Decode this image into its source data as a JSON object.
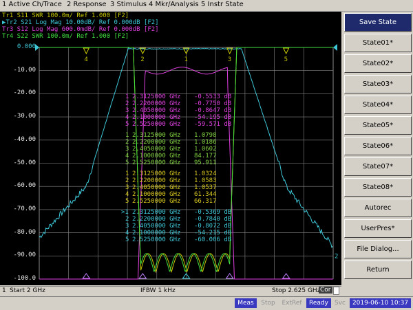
{
  "menu": [
    "1 Active Ch/Trace",
    "2 Response",
    "3 Stimulus",
    "4 Mkr/Analysis",
    "5 Instr State"
  ],
  "traces": [
    {
      "label": "Tr1  S11  SWR 100.0m/ Ref 1.000  [F2]",
      "color": "#c8c800"
    },
    {
      "label": "Tr2  S21  Log Mag 10.00dB/ Ref 0.000dB  [F2]",
      "color": "#3ec8d8"
    },
    {
      "label": "Tr3  S12  Log Mag 600.0mdB/ Ref 0.000dB  [F2]",
      "color": "#e040e0"
    },
    {
      "label": "Tr4  S22  SWR 100.0m/ Ref 1.000  [F2]",
      "color": "#40e040"
    }
  ],
  "active_trace_marker": "▶",
  "y_axis": {
    "labels": [
      "0.000",
      "-10.00",
      "-20.00",
      "-30.00",
      "-40.00",
      "-50.00",
      "-60.00",
      "-70.00",
      "-80.00",
      "-90.00",
      "-100.0"
    ],
    "unit": "dB"
  },
  "marker_tables": [
    {
      "color": "#e040e0",
      "rows": [
        {
          "n": "1",
          "freq": "2.3125000 GHz",
          "val": "-0.5533 dB"
        },
        {
          "n": "2",
          "freq": "2.2200000 GHz",
          "val": "-0.7750 dB"
        },
        {
          "n": "3",
          "freq": "2.4050000 GHz",
          "val": "-0.8647 dB"
        },
        {
          "n": "4",
          "freq": "2.1000000 GHz",
          "val": "-54.195 dB"
        },
        {
          "n": "5",
          "freq": "2.5250000 GHz",
          "val": "-59.571 dB"
        }
      ]
    },
    {
      "color": "#80d040",
      "rows": [
        {
          "n": "1",
          "freq": "2.3125000 GHz",
          "val": "1.0798"
        },
        {
          "n": "2",
          "freq": "2.2200000 GHz",
          "val": "1.0186"
        },
        {
          "n": "3",
          "freq": "2.4050000 GHz",
          "val": "1.0602"
        },
        {
          "n": "4",
          "freq": "2.1000000 GHz",
          "val": "84.177"
        },
        {
          "n": "5",
          "freq": "2.5250000 GHz",
          "val": "95.911"
        }
      ]
    },
    {
      "color": "#d8c820",
      "rows": [
        {
          "n": "1",
          "freq": "2.3125000 GHz",
          "val": "1.0324"
        },
        {
          "n": "2",
          "freq": "2.2200000 GHz",
          "val": "1.0583"
        },
        {
          "n": "3",
          "freq": "2.4050000 GHz",
          "val": "1.0537"
        },
        {
          "n": "4",
          "freq": "2.1000000 GHz",
          "val": "61.344"
        },
        {
          "n": "5",
          "freq": "2.5250000 GHz",
          "val": "66.317"
        }
      ]
    },
    {
      "color": "#3ec8d8",
      "rows": [
        {
          "n": ">1",
          "freq": "2.3125000 GHz",
          "val": "-0.5369 dB"
        },
        {
          "n": "2",
          "freq": "2.2200000 GHz",
          "val": "-0.7840 dB"
        },
        {
          "n": "3",
          "freq": "2.4050000 GHz",
          "val": "-0.8072 dB"
        },
        {
          "n": "4",
          "freq": "2.1000000 GHz",
          "val": "-54.215 dB"
        },
        {
          "n": "5",
          "freq": "2.5250000 GHz",
          "val": "-60.006 dB"
        }
      ]
    }
  ],
  "plot_markers": [
    "1",
    "2",
    "3",
    "4",
    "5"
  ],
  "trace_end_label": "2",
  "softkeys": [
    "Save State",
    "State01*",
    "State02*",
    "State03*",
    "State04*",
    "State05*",
    "State06*",
    "State07*",
    "State08*",
    "Autorec",
    "UserPres*",
    "File Dialog...",
    "Return"
  ],
  "bottom": {
    "channel": "1",
    "start": "Start 2 GHz",
    "ifbw": "IFBW 1 kHz",
    "stop": "Stop 2.625 GHz",
    "cor": "Cor"
  },
  "status": {
    "meas": "Meas",
    "stop": "Stop",
    "extref": "ExtRef",
    "ready": "Ready",
    "svc": "Svc",
    "datetime": "2019-06-10 10:37"
  },
  "colors": {
    "tr1": "#c8c800",
    "tr2": "#3ec8d8",
    "tr3": "#e040e0",
    "tr4": "#40e040",
    "grid": "#8a8a8a",
    "active_key": "#1e2a6c"
  }
}
